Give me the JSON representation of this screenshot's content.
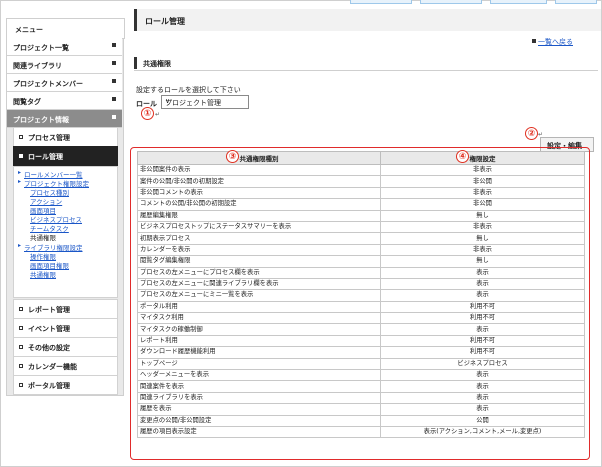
{
  "sidebar": {
    "header": "メニュー",
    "items": [
      {
        "label": "プロジェクト一覧"
      },
      {
        "label": "関連ライブラリ"
      },
      {
        "label": "プロジェクトメンバー"
      },
      {
        "label": "閲覧タグ"
      },
      {
        "label": "プロジェクト情報"
      }
    ],
    "subitems": [
      {
        "label": "プロセス管理"
      },
      {
        "label": "ロール管理"
      }
    ],
    "nav_links": [
      "ロールメンバー一覧",
      "プロジェクト権限設定",
      "プロセス種別",
      "アクション",
      "画面項目",
      "ビジネスプロセス",
      "チームタスク",
      "共通権限",
      "ライブラリ権限設定",
      "操作権限",
      "画面項目権限",
      "共通権限"
    ],
    "bottom_items": [
      {
        "label": "レポート管理"
      },
      {
        "label": "イベント管理"
      },
      {
        "label": "その他の設定"
      },
      {
        "label": "カレンダー機能"
      },
      {
        "label": "ポータル管理"
      }
    ]
  },
  "main": {
    "title": "ロール管理",
    "back_link": "一覧へ戻る",
    "section_title": "共通権限",
    "instruction": "設定するロールを選択して下さい",
    "role_label": "ロール",
    "role_selected": "プロジェクト管理",
    "edit_button": "設定・編集",
    "badges": [
      "①",
      "②",
      "③",
      "④"
    ],
    "table": {
      "headers": [
        "共通権限種別",
        "権限設定"
      ],
      "rows": [
        [
          "非公開案件の表示",
          "非表示"
        ],
        [
          "案件の公開/非公開の初期設定",
          "非公開"
        ],
        [
          "非公開コメントの表示",
          "非表示"
        ],
        [
          "コメントの公開/非公開の初期設定",
          "非公開"
        ],
        [
          "履歴編集権限",
          "無し"
        ],
        [
          "ビジネスプロセストップにステータスサマリーを表示",
          "非表示"
        ],
        [
          "初期表示プロセス",
          "無し"
        ],
        [
          "カレンダーを表示",
          "非表示"
        ],
        [
          "閲覧タグ編集権限",
          "無し"
        ],
        [
          "プロセスの左メニューにプロセス欄を表示",
          "表示"
        ],
        [
          "プロセスの左メニューに関連ライブラリ欄を表示",
          "表示"
        ],
        [
          "プロセスの左メニューにミニ一覧を表示",
          "表示"
        ],
        [
          "ポータル利用",
          "利用不可"
        ],
        [
          "マイタスク利用",
          "利用不可"
        ],
        [
          "マイタスクの稼働制御",
          "表示"
        ],
        [
          "レポート利用",
          "利用不可"
        ],
        [
          "ダウンロード履歴機能利用",
          "利用不可"
        ],
        [
          "トップページ",
          "ビジネスプロセス"
        ],
        [
          "ヘッダーメニューを表示",
          "表示"
        ],
        [
          "関連案件を表示",
          "表示"
        ],
        [
          "関連ライブラリを表示",
          "表示"
        ],
        [
          "履歴を表示",
          "表示"
        ],
        [
          "変更点の公開/非公開設定",
          "公開"
        ],
        [
          "履歴の項目表示設定",
          "表示(アクション,コメント,メール,変更点)"
        ]
      ]
    }
  },
  "colors": {
    "accent": "#e02b2b",
    "link": "#1a56c7",
    "active": "#8c8c8c"
  }
}
